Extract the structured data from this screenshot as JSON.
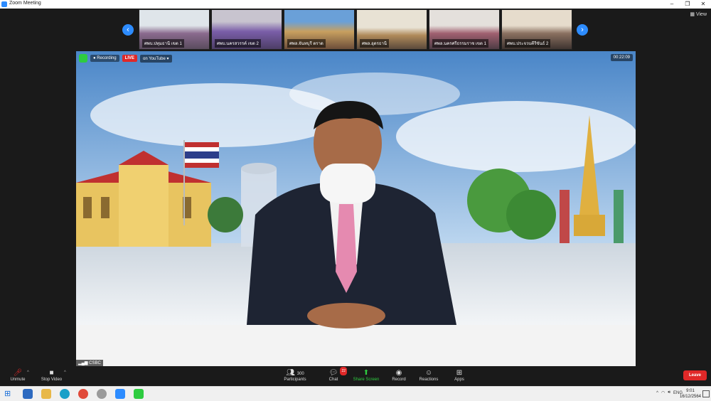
{
  "window": {
    "title": "Zoom Meeting",
    "view_label": "View"
  },
  "thumbnails": [
    {
      "label": "ศพบ.ปทุมธานี เขต 1"
    },
    {
      "label": "ศพบ.นครสวรรค์ เขต 2"
    },
    {
      "label": "ศพล.จันทบุรี ตราด"
    },
    {
      "label": "ศพล.อุดรธานี"
    },
    {
      "label": "ศพล.นครศรีธรรมราช เขต 1"
    },
    {
      "label": "ศพบ.ประจวบคีรีขันธ์ 2"
    }
  ],
  "video": {
    "recording_label": "Recording",
    "live_label": "LIVE",
    "youtube_label": "on YouTube",
    "timer": "00:22:09",
    "participant_name": "CSBC"
  },
  "toolbar": {
    "unmute": "Unmute",
    "stop_video": "Stop Video",
    "participants_count": "300",
    "participants": "Participants",
    "chat": "Chat",
    "chat_badge": "22",
    "share_screen": "Share Screen",
    "record": "Record",
    "reactions": "Reactions",
    "apps": "Apps",
    "leave": "Leave"
  },
  "taskbar": {
    "lang": "ENG",
    "time": "9:01",
    "date": "16/12/2564"
  },
  "colors": {
    "accent": "#2d8cff",
    "live": "#e02828",
    "share": "#2ecc40"
  }
}
